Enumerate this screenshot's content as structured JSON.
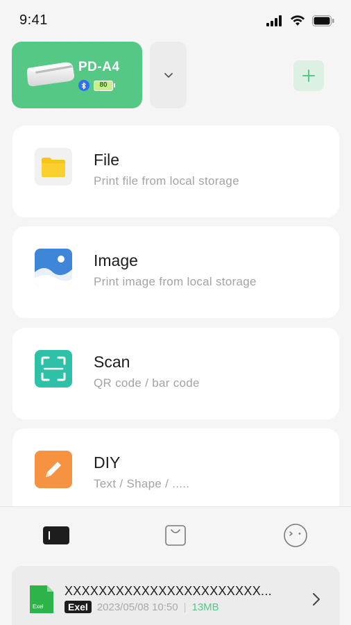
{
  "status_bar": {
    "time": "9:41"
  },
  "device": {
    "name": "PD-A4",
    "battery": "80",
    "bluetooth_icon": "bluetooth-icon",
    "dropdown_icon": "chevron-down-icon",
    "add_icon": "plus-icon",
    "accent_color": "#55c886"
  },
  "options": [
    {
      "title": "File",
      "subtitle": "Print file from local storage",
      "icon": "folder-icon"
    },
    {
      "title": "Image",
      "subtitle": "Print image from local storage",
      "icon": "image-icon"
    },
    {
      "title": "Scan",
      "subtitle": "QR code / bar code",
      "icon": "scan-icon"
    },
    {
      "title": "DIY",
      "subtitle": "Text / Shape / .....",
      "icon": "pencil-icon"
    }
  ],
  "bottom_nav": [
    "printer-tab-icon",
    "shop-bag-icon",
    "profile-face-icon"
  ],
  "recent_file": {
    "name": "XXXXXXXXXXXXXXXXXXXXXXX...",
    "type": "Exel",
    "icon_label": "Exel",
    "date": "2023/05/08 10:50",
    "separator": "|",
    "size": "13MB"
  }
}
